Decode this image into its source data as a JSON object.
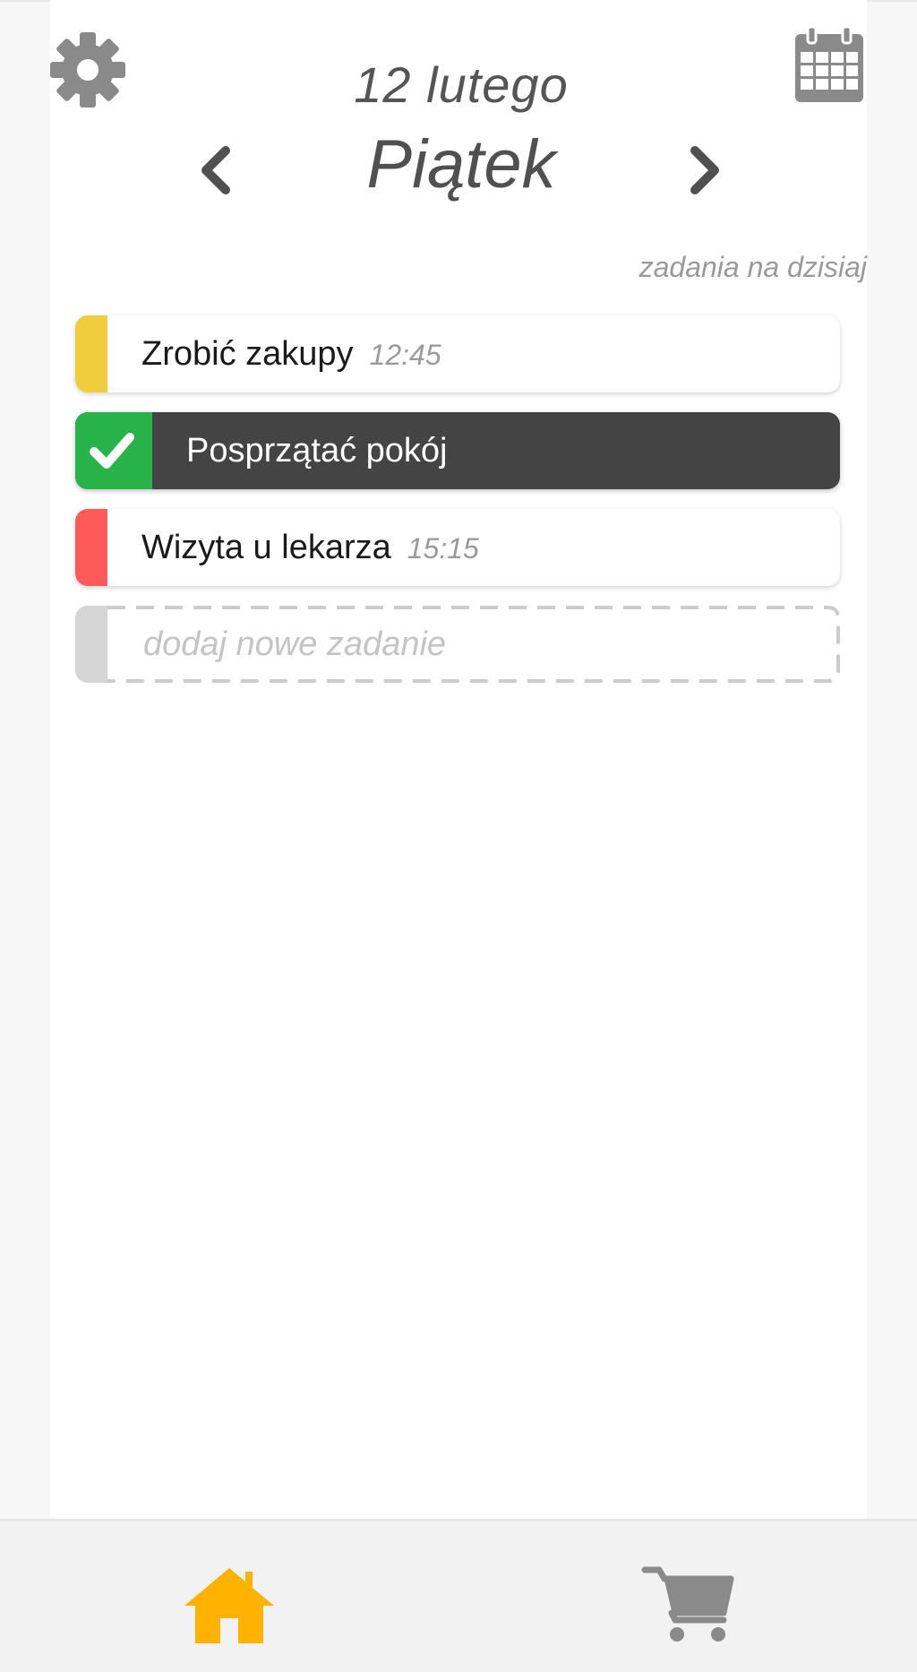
{
  "header": {
    "date": "12 lutego",
    "day": "Piątek",
    "settings_icon": "gear-icon",
    "calendar_icon": "calendar-icon",
    "prev_icon": "chevron-left-icon",
    "next_icon": "chevron-right-icon"
  },
  "section_label": "zadania na dzisiaj",
  "tasks": [
    {
      "title": "Zrobić zakupy",
      "time": "12:45",
      "color": "#f0cd3c",
      "done": false
    },
    {
      "title": "Posprzątać pokój",
      "time": "",
      "color": "#27b24a",
      "done": true
    },
    {
      "title": "Wizyta u lekarza",
      "time": "15:15",
      "color": "#ff5a5a",
      "done": false
    }
  ],
  "add_task": {
    "placeholder": "dodaj nowe zadanie",
    "color": "#d5d5d5"
  },
  "bottom_nav": {
    "home_icon": "home-icon",
    "home_color": "#ffb300",
    "cart_icon": "cart-icon",
    "cart_color": "#8a8a8a"
  },
  "colors": {
    "done_background": "#444444",
    "icon_gray": "#8a8a8a",
    "nav_arrow": "#505050"
  }
}
